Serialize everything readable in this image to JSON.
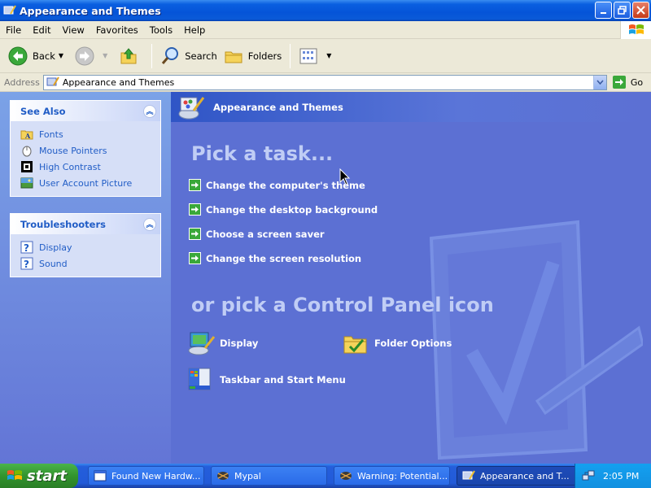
{
  "window": {
    "title": "Appearance and Themes"
  },
  "menubar": {
    "items": [
      "File",
      "Edit",
      "View",
      "Favorites",
      "Tools",
      "Help"
    ]
  },
  "toolbar": {
    "back_label": "Back",
    "search_label": "Search",
    "folders_label": "Folders"
  },
  "address": {
    "label": "Address",
    "value": "Appearance and Themes",
    "go_label": "Go"
  },
  "sidebar": {
    "see_also": {
      "title": "See Also",
      "items": [
        "Fonts",
        "Mouse Pointers",
        "High Contrast",
        "User Account Picture"
      ]
    },
    "troubleshooters": {
      "title": "Troubleshooters",
      "items": [
        "Display",
        "Sound"
      ]
    }
  },
  "main": {
    "header_title": "Appearance and Themes",
    "pick_task": "Pick a task...",
    "tasks": [
      "Change the computer's theme",
      "Change the desktop background",
      "Choose a screen saver",
      "Change the screen resolution"
    ],
    "pick_icon": "or pick a Control Panel icon",
    "icons": [
      "Display",
      "Folder Options",
      "Taskbar and Start Menu"
    ]
  },
  "taskbar": {
    "start_label": "start",
    "buttons": [
      "Found New Hardw...",
      "Mypal",
      "Warning: Potential...",
      "Appearance and T..."
    ],
    "clock": "2:05 PM"
  },
  "colors": {
    "link": "#215dc6",
    "panel": "#5c70d3",
    "sidebar": "#7ba2e7"
  }
}
